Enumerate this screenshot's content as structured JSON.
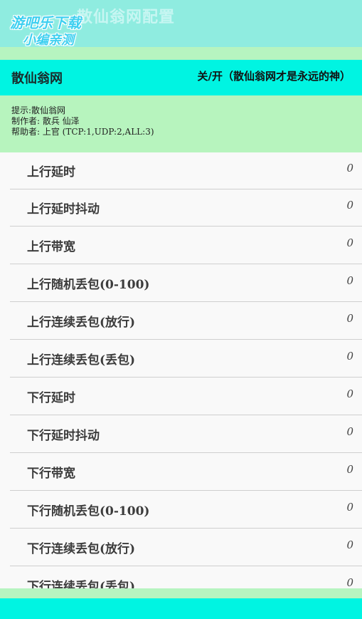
{
  "header": {
    "title": "散仙翁网配置"
  },
  "watermark": {
    "line1": "游吧乐下载",
    "line2": "小编亲测"
  },
  "bar": {
    "title": "散仙翁网",
    "toggle_label": "关/开（散仙翁网才是永远的神）"
  },
  "info": {
    "tip": "提示:散仙翁网",
    "author": "制作者: 散兵   仙泽",
    "helper": "帮助者: 上官  (TCP:1,UDP:2,ALL:3)"
  },
  "settings": [
    {
      "label": "上行延时",
      "value": "0"
    },
    {
      "label": "上行延时抖动",
      "value": "0"
    },
    {
      "label": "上行带宽",
      "value": "0"
    },
    {
      "label": "上行随机丢包(0-100)",
      "value": "0"
    },
    {
      "label": "上行连续丢包(放行)",
      "value": "0"
    },
    {
      "label": "上行连续丢包(丢包)",
      "value": "0"
    },
    {
      "label": "下行延时",
      "value": "0"
    },
    {
      "label": "下行延时抖动",
      "value": "0"
    },
    {
      "label": "下行带宽",
      "value": "0"
    },
    {
      "label": "下行随机丢包(0-100)",
      "value": "0"
    },
    {
      "label": "下行连续丢包(放行)",
      "value": "0"
    },
    {
      "label": "下行连续丢包(丢包)",
      "value": "0"
    }
  ]
}
